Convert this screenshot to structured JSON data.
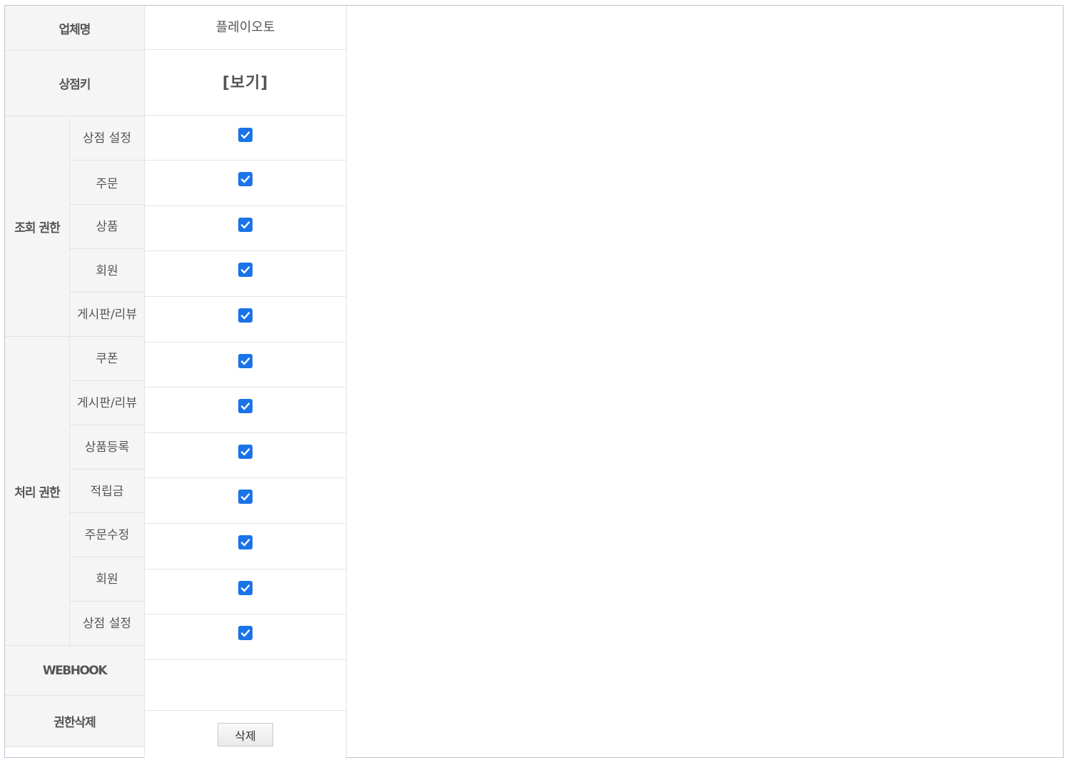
{
  "company": {
    "label": "업체명",
    "value": "플레이오토"
  },
  "store_key": {
    "label": "상점키",
    "link_text": "[보기]"
  },
  "view_permissions": {
    "group_label": "조회 권한",
    "items": [
      {
        "label": "상점 설정",
        "checked": true
      },
      {
        "label": "주문",
        "checked": true
      },
      {
        "label": "상품",
        "checked": true
      },
      {
        "label": "회원",
        "checked": true
      },
      {
        "label": "게시판/리뷰",
        "checked": true
      }
    ]
  },
  "process_permissions": {
    "group_label": "처리 권한",
    "items": [
      {
        "label": "쿠폰",
        "checked": true
      },
      {
        "label": "게시판/리뷰",
        "checked": true
      },
      {
        "label": "상품등록",
        "checked": true
      },
      {
        "label": "적립금",
        "checked": true
      },
      {
        "label": "주문수정",
        "checked": true
      },
      {
        "label": "회원",
        "checked": true
      },
      {
        "label": "상점 설정",
        "checked": true
      }
    ]
  },
  "webhook": {
    "label": "WEBHOOK",
    "value": ""
  },
  "delete_permission": {
    "label": "권한삭제",
    "button_label": "삭제"
  },
  "colors": {
    "checkbox": "#1a73e8",
    "header_bg": "#f5f5f5",
    "frame_border": "#b9c4d1"
  }
}
